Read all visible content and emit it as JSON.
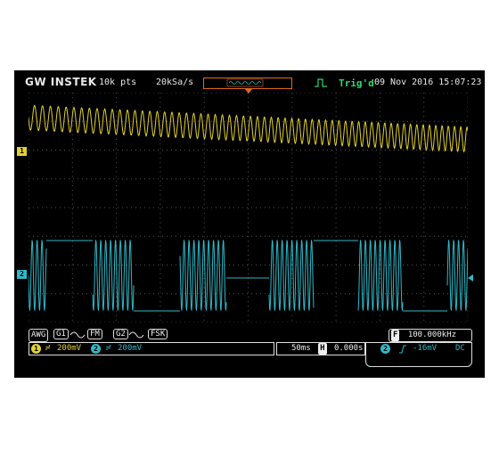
{
  "brand": "GW INSTEK",
  "header": {
    "record_length": "10k pts",
    "sample_rate": "20kSa/s",
    "trigger_status": "Trig'd",
    "datetime": "09 Nov 2016 15:07:23"
  },
  "awg": {
    "label": "AWG",
    "g1": "G1",
    "fm": "FM",
    "g2": "G2",
    "fsk": "FSK",
    "freq_badge": "F",
    "frequency": "100.000kHz"
  },
  "channels": {
    "ch1_marker": "1",
    "ch2_marker": "2",
    "ch1_scale": "200mV",
    "ch2_scale": "200mV",
    "ch1_color": "#e2d02e",
    "ch2_color": "#2fb8c8"
  },
  "timebase": {
    "scale": "50ms",
    "h_badge": "H",
    "position": "0.000s"
  },
  "trigger": {
    "source": "2",
    "slope_icon": "rising-edge-icon",
    "level": "-16mV",
    "coupling": "DC"
  },
  "colors": {
    "accent": "#e06a1e",
    "trig_ok": "#2fd86a",
    "background": "#000000"
  }
}
